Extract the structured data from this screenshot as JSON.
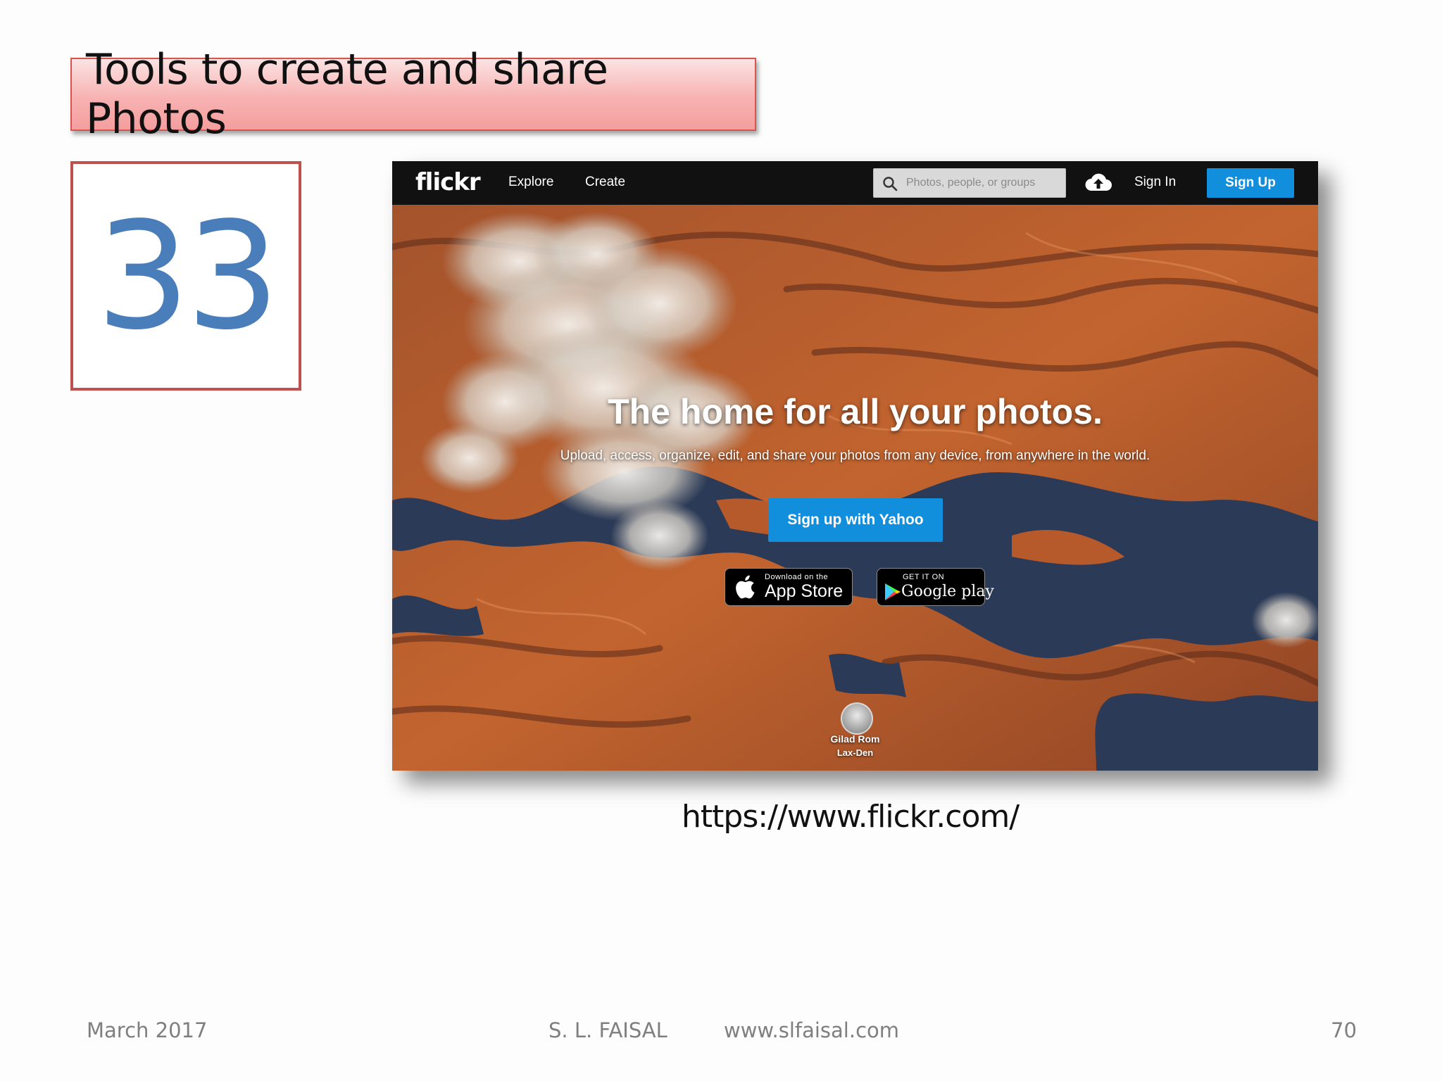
{
  "slide": {
    "title": "Tools to create and share Photos",
    "number": "33",
    "url_caption": "https://www.flickr.com/",
    "footer": {
      "date": "March 2017",
      "author": "S. L. FAISAL",
      "website": "www.slfaisal.com",
      "page_number": "70"
    }
  },
  "flickr": {
    "logo": "flickr",
    "nav": {
      "explore": "Explore",
      "create": "Create"
    },
    "search_placeholder": "Photos, people, or groups",
    "upload_icon": "cloud-upload-icon",
    "sign_in": "Sign In",
    "sign_up": "Sign Up",
    "hero": {
      "headline": "The home for all your photos.",
      "subline": "Upload, access, organize, edit, and share your photos from any device, from anywhere in the world.",
      "cta": "Sign up with Yahoo",
      "app_store": {
        "small": "Download on the",
        "big": "App Store",
        "icon": "apple-icon"
      },
      "google_play": {
        "small": "GET IT ON",
        "big": "Google play",
        "icon": "play-icon"
      },
      "credit_name": "Gilad Rom",
      "credit_title": "Lax-Den"
    }
  },
  "colors": {
    "accent_blue": "#128fdc",
    "title_border": "#d9534f",
    "number_color": "#4a7ebb",
    "number_border": "#c0504d"
  }
}
